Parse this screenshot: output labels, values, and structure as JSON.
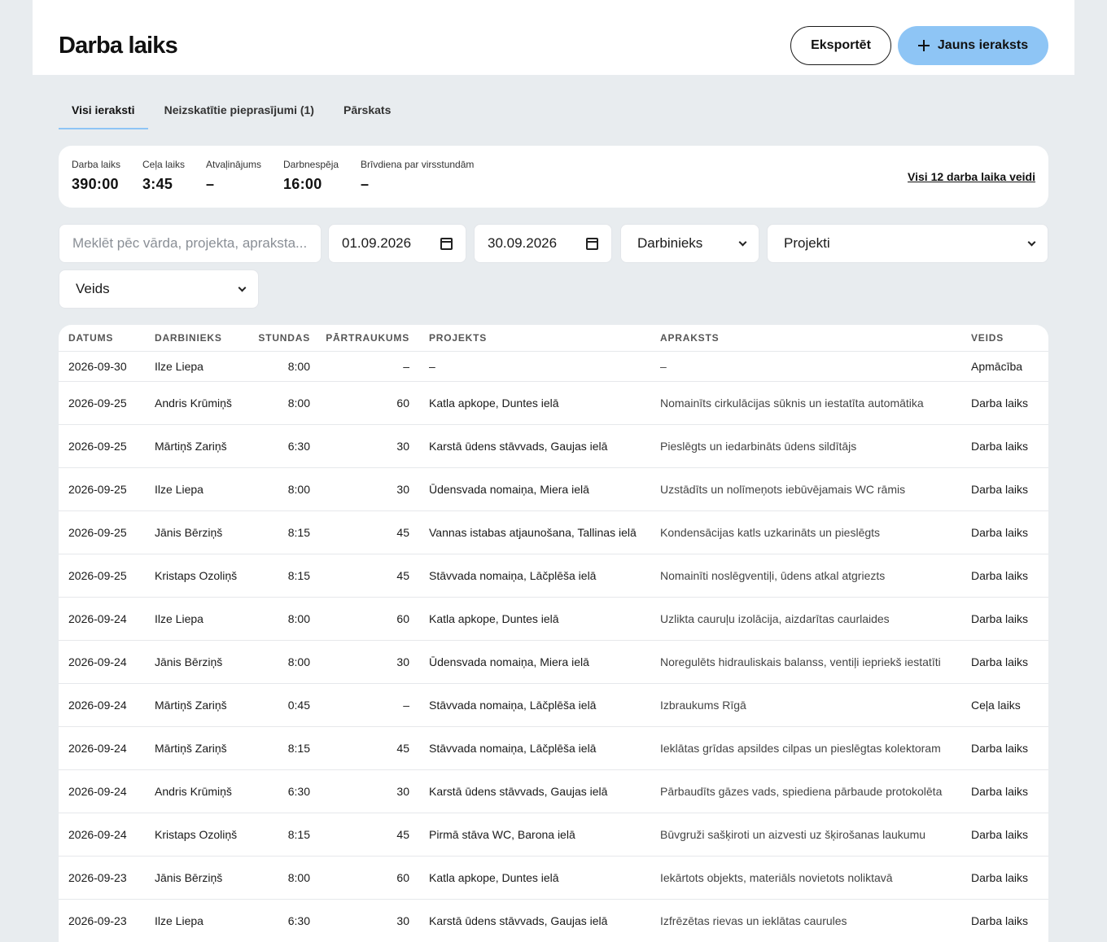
{
  "header": {
    "title": "Darba laiks",
    "export_label": "Eksportēt",
    "new_label": "Jauns ieraksts"
  },
  "tabs": [
    {
      "label": "Visi ieraksti",
      "active": true
    },
    {
      "label": "Neizskatītie pieprasījumi (1)",
      "active": false
    },
    {
      "label": "Pārskats",
      "active": false
    }
  ],
  "summary": {
    "stats": [
      {
        "label": "Darba laiks",
        "value": "390:00"
      },
      {
        "label": "Ceļa laiks",
        "value": "3:45"
      },
      {
        "label": "Atvaļinājums",
        "value": "–"
      },
      {
        "label": "Darbnespēja",
        "value": "16:00"
      },
      {
        "label": "Brīvdiena par virsstundām",
        "value": "–"
      }
    ],
    "link_label": "Visi 12 darba laika veidi"
  },
  "filters": {
    "search_placeholder": "Meklēt pēc vārda, projekta, apraksta...",
    "date_from": "01.09.2026",
    "date_to": "30.09.2026",
    "employee_select": "Darbinieks",
    "project_select": "Projekti",
    "type_select": "Veids"
  },
  "table": {
    "columns": [
      "Datums",
      "Darbinieks",
      "Stundas",
      "Pārtraukums",
      "Projekts",
      "Apraksts",
      "Veids"
    ],
    "rows": [
      [
        "2026-09-30",
        "Ilze Liepa",
        "8:00",
        "–",
        "–",
        "–",
        "Apmācība"
      ],
      [
        "2026-09-25",
        "Andris Krūmiņš",
        "8:00",
        "60",
        "Katla apkope, Duntes ielā",
        "Nomainīts cirkulācijas sūknis un iestatīta automātika",
        "Darba laiks"
      ],
      [
        "2026-09-25",
        "Mārtiņš Zariņš",
        "6:30",
        "30",
        "Karstā ūdens stāvvads, Gaujas ielā",
        "Pieslēgts un iedarbināts ūdens sildītājs",
        "Darba laiks"
      ],
      [
        "2026-09-25",
        "Ilze Liepa",
        "8:00",
        "30",
        "Ūdensvada nomaiņa, Miera ielā",
        "Uzstādīts un nolīmeņots iebūvējamais WC rāmis",
        "Darba laiks"
      ],
      [
        "2026-09-25",
        "Jānis Bērziņš",
        "8:15",
        "45",
        "Vannas istabas atjaunošana, Tallinas ielā",
        "Kondensācijas katls uzkarināts un pieslēgts",
        "Darba laiks"
      ],
      [
        "2026-09-25",
        "Kristaps Ozoliņš",
        "8:15",
        "45",
        "Stāvvada nomaiņa, Lāčplēša ielā",
        "Nomainīti noslēgventiļi, ūdens atkal atgriezts",
        "Darba laiks"
      ],
      [
        "2026-09-24",
        "Ilze Liepa",
        "8:00",
        "60",
        "Katla apkope, Duntes ielā",
        "Uzlikta cauruļu izolācija, aizdarītas caurlaides",
        "Darba laiks"
      ],
      [
        "2026-09-24",
        "Jānis Bērziņš",
        "8:00",
        "30",
        "Ūdensvada nomaiņa, Miera ielā",
        "Noregulēts hidrauliskais balanss, ventiļi iepriekš iestatīti",
        "Darba laiks"
      ],
      [
        "2026-09-24",
        "Mārtiņš Zariņš",
        "0:45",
        "–",
        "Stāvvada nomaiņa, Lāčplēša ielā",
        "Izbraukums Rīgā",
        "Ceļa laiks"
      ],
      [
        "2026-09-24",
        "Mārtiņš Zariņš",
        "8:15",
        "45",
        "Stāvvada nomaiņa, Lāčplēša ielā",
        "Ieklātas grīdas apsildes cilpas un pieslēgtas kolektoram",
        "Darba laiks"
      ],
      [
        "2026-09-24",
        "Andris Krūmiņš",
        "6:30",
        "30",
        "Karstā ūdens stāvvads, Gaujas ielā",
        "Pārbaudīts gāzes vads, spiediena pārbaude protokolēta",
        "Darba laiks"
      ],
      [
        "2026-09-24",
        "Kristaps Ozoliņš",
        "8:15",
        "45",
        "Pirmā stāva WC, Barona ielā",
        "Būvgruži sašķiroti un aizvesti uz šķirošanas laukumu",
        "Darba laiks"
      ],
      [
        "2026-09-23",
        "Jānis Bērziņš",
        "8:00",
        "60",
        "Katla apkope, Duntes ielā",
        "Iekārtots objekts, materiāls novietots noliktavā",
        "Darba laiks"
      ],
      [
        "2026-09-23",
        "Ilze Liepa",
        "6:30",
        "30",
        "Karstā ūdens stāvvads, Gaujas ielā",
        "Izfrēzētas rievas un ieklātas caurules",
        "Darba laiks"
      ]
    ]
  }
}
